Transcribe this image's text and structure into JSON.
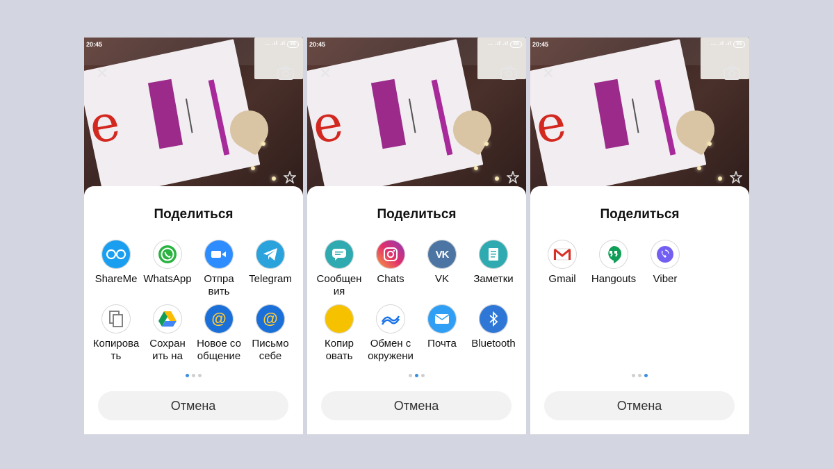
{
  "status": {
    "time": "20:45",
    "signal": "... .ıl .ıl",
    "battery": "36"
  },
  "sheet_title": "Поделиться",
  "cancel_label": "Отмена",
  "colors": {
    "accent": "#3a8fe0",
    "background": "#d3d6e1"
  },
  "pages": [
    {
      "active_dot": 0,
      "apps": [
        {
          "icon": "shareme-icon",
          "label": "ShareMe",
          "label2": ""
        },
        {
          "icon": "whatsapp-icon",
          "label": "WhatsApp",
          "label2": ""
        },
        {
          "icon": "zoom-icon",
          "label": "Отпра",
          "label2": "вить"
        },
        {
          "icon": "telegram-icon",
          "label": "Telegram",
          "label2": ""
        },
        {
          "icon": "copy-icon",
          "label": "Копирова",
          "label2": "ть"
        },
        {
          "icon": "google-drive-icon",
          "label": "Сохран",
          "label2": "ить на"
        },
        {
          "icon": "mail-at-icon",
          "label": "Новое со",
          "label2": "общение"
        },
        {
          "icon": "mail-at-icon",
          "label": "Письмо",
          "label2": "себе"
        }
      ]
    },
    {
      "active_dot": 1,
      "apps": [
        {
          "icon": "messages-icon",
          "label": "Сообщен",
          "label2": "ия"
        },
        {
          "icon": "instagram-icon",
          "label": "Chats",
          "label2": ""
        },
        {
          "icon": "vk-icon",
          "label": "VK",
          "label2": ""
        },
        {
          "icon": "notes-icon",
          "label": "Заметки",
          "label2": ""
        },
        {
          "icon": "copy-yellow-icon",
          "label": "Копир",
          "label2": "овать"
        },
        {
          "icon": "nearby-share-icon",
          "label": "Обмен с",
          "label2": "окружени"
        },
        {
          "icon": "email-icon",
          "label": "Почта",
          "label2": ""
        },
        {
          "icon": "bluetooth-icon",
          "label": "Bluetooth",
          "label2": ""
        }
      ]
    },
    {
      "active_dot": 2,
      "apps": [
        {
          "icon": "gmail-icon",
          "label": "Gmail",
          "label2": ""
        },
        {
          "icon": "hangouts-icon",
          "label": "Hangouts",
          "label2": ""
        },
        {
          "icon": "viber-icon",
          "label": "Viber",
          "label2": ""
        }
      ]
    }
  ]
}
